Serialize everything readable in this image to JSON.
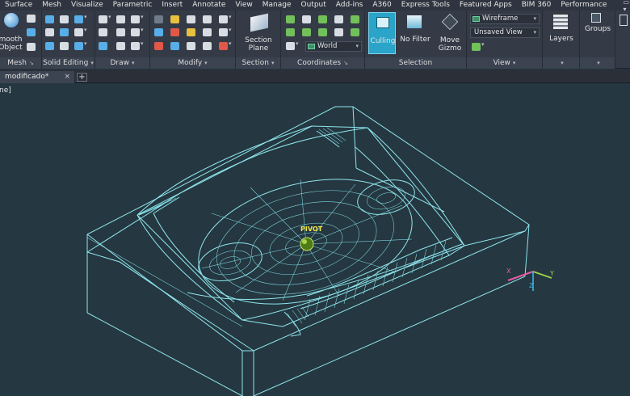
{
  "menu": {
    "items": [
      "Surface",
      "Mesh",
      "Visualize",
      "Parametric",
      "Insert",
      "Annotate",
      "View",
      "Manage",
      "Output",
      "Add-ins",
      "A360",
      "Express Tools",
      "Featured Apps",
      "BIM 360",
      "Performance"
    ],
    "extra": "▭ ▾"
  },
  "ribbon": {
    "mesh": {
      "smooth_label_1": "mooth",
      "smooth_label_2": "Object",
      "title": "Mesh"
    },
    "solid_editing": {
      "title": "Solid Editing"
    },
    "draw": {
      "title": "Draw"
    },
    "modify": {
      "title": "Modify"
    },
    "section": {
      "plane_label_1": "Section",
      "plane_label_2": "Plane",
      "title": "Section"
    },
    "coordinates": {
      "ucs_value": "World",
      "title": "Coordinates"
    },
    "selection": {
      "culling_label": "Culling",
      "filter_label": "No Filter",
      "gizmo_label_1": "Move",
      "gizmo_label_2": "Gizmo",
      "title": "Selection"
    },
    "view": {
      "visual_style": "Wireframe",
      "named_view": "Unsaved View",
      "title": "View"
    },
    "layers": {
      "label": "Layers"
    },
    "groups": {
      "label": "Groups"
    }
  },
  "tabs": {
    "document": "modificado*",
    "close": "×",
    "new": "+"
  },
  "viewport": {
    "label": "ne]",
    "pivot_label": "PIVOT",
    "axis_x": "X",
    "axis_y": "Y",
    "axis_z": "Z"
  },
  "colors": {
    "viewport_bg": "#253740",
    "wire": "#8fe6ee",
    "accent": "#2aa4c8",
    "pivot_text": "#f2e84a",
    "pivot_ball": "#4f7a18"
  }
}
